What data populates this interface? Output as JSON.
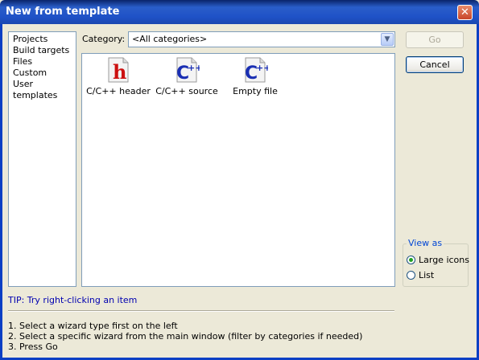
{
  "window": {
    "title": "New from template",
    "close_label": "✕"
  },
  "sidebar": {
    "items": [
      "Projects",
      "Build targets",
      "Files",
      "Custom",
      "User templates"
    ]
  },
  "category": {
    "label": "Category:",
    "selected": "<All categories>"
  },
  "templates": [
    {
      "label": "C/C++ header",
      "icon": "c-header-icon"
    },
    {
      "label": "C/C++ source",
      "icon": "c-source-icon"
    },
    {
      "label": "Empty file",
      "icon": "empty-file-icon"
    }
  ],
  "buttons": {
    "go": "Go",
    "cancel": "Cancel"
  },
  "view_as": {
    "title": "View as",
    "large_icons": "Large icons",
    "list": "List",
    "selected": "Large icons"
  },
  "tip": "TIP: Try right-clicking an item",
  "help": [
    "1. Select a wizard type first on the left",
    "2. Select a specific wizard from the main window (filter by categories if needed)",
    "3. Press Go"
  ]
}
